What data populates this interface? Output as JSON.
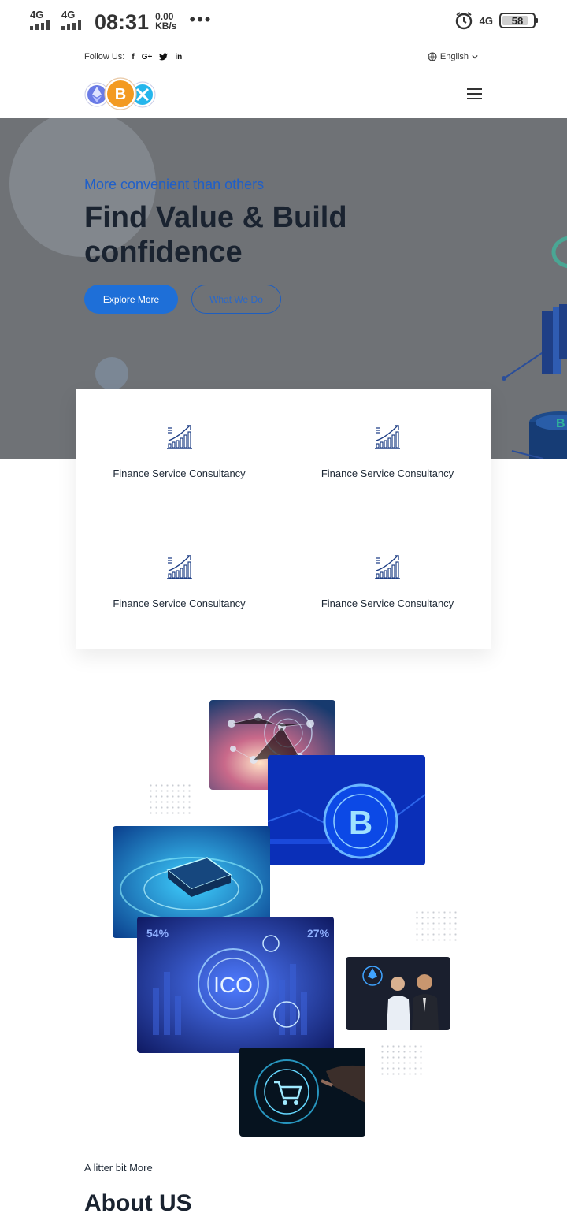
{
  "status_bar": {
    "net1": "4G",
    "net2": "4G",
    "time": "08:31",
    "speed_value": "0.00",
    "speed_unit": "KB/s",
    "more": "•••",
    "net3": "4G",
    "battery": "58"
  },
  "topbar": {
    "follow_label": "Follow Us:",
    "social": [
      "f",
      "G+",
      "t",
      "in"
    ],
    "language": "English"
  },
  "hero": {
    "subtitle": "More convenient than others",
    "title": "Find Value & Build confidence",
    "primary_button": "Explore More",
    "secondary_button": "What We Do"
  },
  "services": [
    {
      "label": "Finance Service Consultancy",
      "icon": "growth-chart-icon"
    },
    {
      "label": "Finance Service Consultancy",
      "icon": "growth-chart-icon"
    },
    {
      "label": "Finance Service Consultancy",
      "icon": "growth-chart-icon"
    },
    {
      "label": "Finance Service Consultancy",
      "icon": "growth-chart-icon"
    }
  ],
  "collage_labels": {
    "ico": "ICO",
    "pct_left": "54%",
    "pct_right": "27%"
  },
  "about": {
    "subtitle": "A litter bit More",
    "title": "About US"
  },
  "colors": {
    "accent": "#1e6fd8",
    "hero_overlay": "#6f7276",
    "title_dark": "#1a2330"
  }
}
